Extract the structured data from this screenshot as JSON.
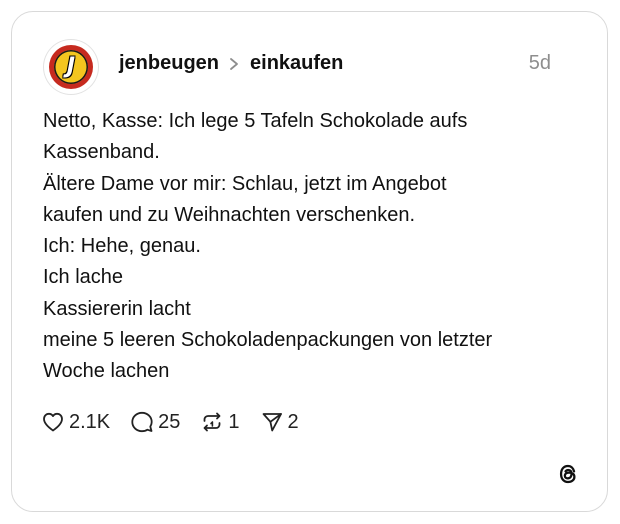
{
  "post": {
    "username": "jenbeugen",
    "community": "einkaufen",
    "time": "5d",
    "avatar_letter": "J",
    "lines": [
      "Netto, Kasse: Ich lege 5 Tafeln Schokolade aufs",
      "Kassenband.",
      "Ältere Dame vor mir: Schlau, jetzt im Angebot",
      "kaufen und zu Weihnachten verschenken.",
      "Ich: Hehe, genau.",
      "Ich lache",
      "Kassiererin lacht",
      "meine 5 leeren Schokoladenpackungen von letzter",
      "Woche lachen"
    ]
  },
  "actions": {
    "likes": "2.1K",
    "replies": "25",
    "reposts": "1",
    "shares": "2"
  },
  "icons": {
    "like": "heart-icon",
    "reply": "speech-bubble-icon",
    "repost": "repost-icon",
    "share": "send-icon",
    "brand": "threads-logo-icon"
  },
  "colors": {
    "avatar_ring": "#c62a1f",
    "avatar_core": "#f3c61f",
    "muted_text": "#8e8e8e",
    "card_border": "#d9d9d9"
  }
}
